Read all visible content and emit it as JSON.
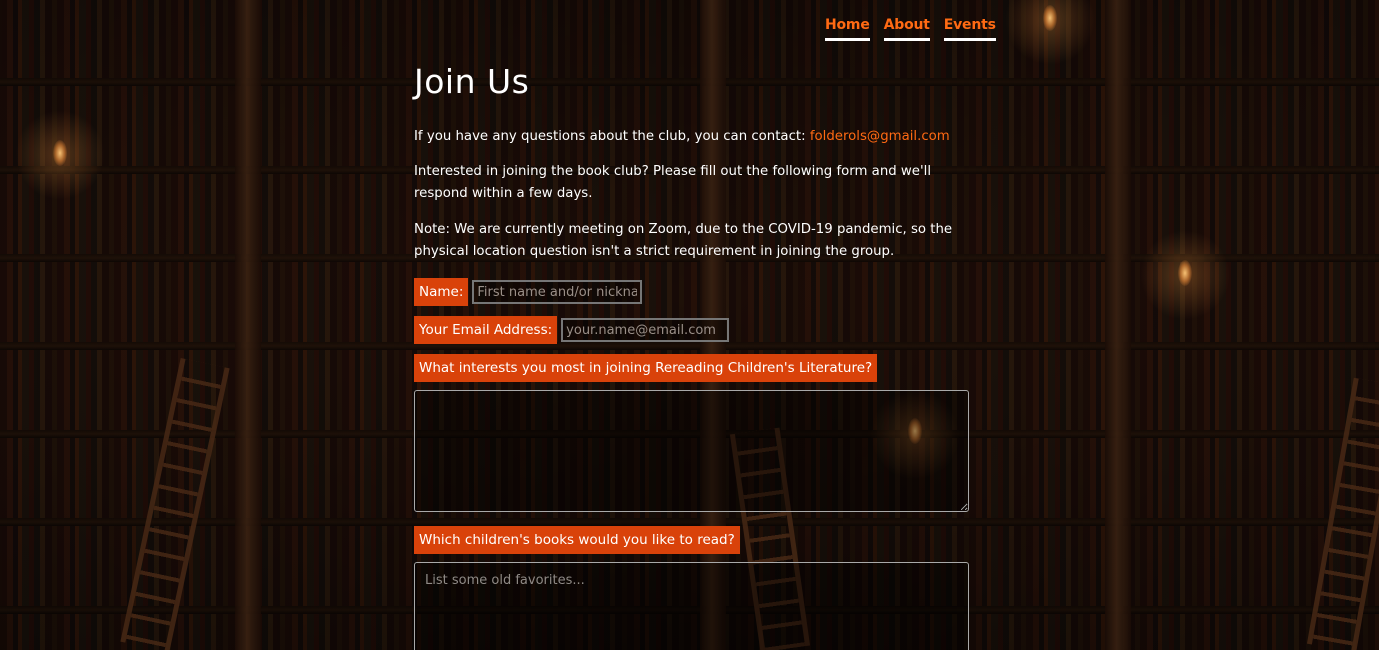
{
  "nav": {
    "items": [
      {
        "label": "Home"
      },
      {
        "label": "About"
      },
      {
        "label": "Events"
      }
    ]
  },
  "main": {
    "title": "Join Us",
    "contact_text": "If you have any questions about the club, you can contact: ",
    "contact_email": "folderols@gmail.com",
    "intro_text": "Interested in joining the book club? Please fill out the following form and we'll respond within a few days.",
    "note_text": "Note: We are currently meeting on Zoom, due to the COVID-19 pandemic, so the physical location question isn't a strict requirement in joining the group."
  },
  "form": {
    "name_label": "Name:",
    "name_placeholder": "First name and/or nickname",
    "email_label": "Your Email Address:",
    "email_placeholder": "your.name@email.com",
    "interest_label": "What interests you most in joining Rereading Children's Literature?",
    "interest_placeholder": "",
    "books_label": "Which children's books would you like to read?",
    "books_placeholder": "List some old favorites..."
  },
  "colors": {
    "accent": "#ff6a13",
    "label_bg": "#d9420a",
    "text": "#ffffff"
  }
}
